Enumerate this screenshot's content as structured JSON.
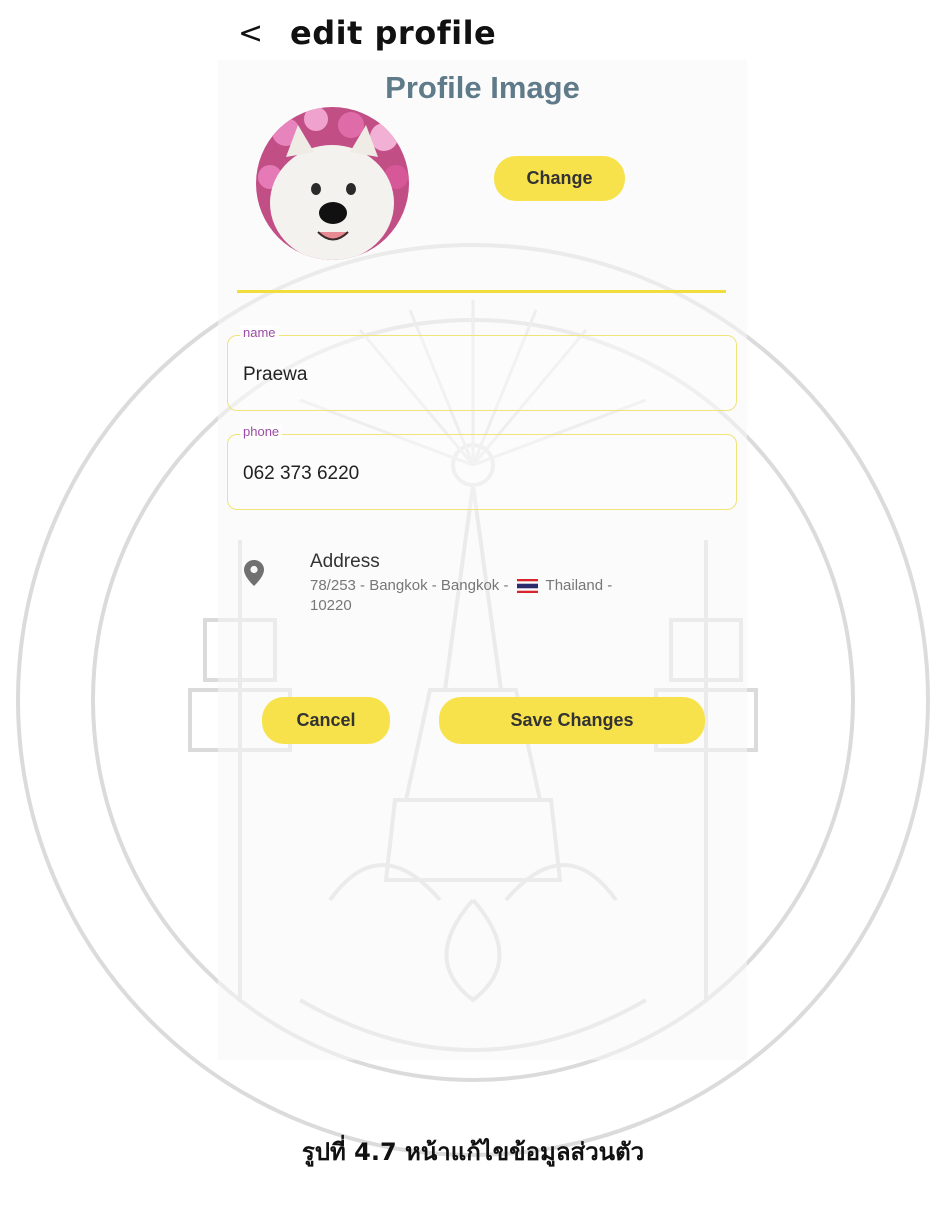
{
  "header": {
    "back_label": "<",
    "title": "edit profile"
  },
  "profile": {
    "section_title": "Profile Image",
    "change_label": "Change"
  },
  "form": {
    "name": {
      "label": "name",
      "value": "Praewa"
    },
    "phone": {
      "label": "phone",
      "value": "062 373 6220"
    },
    "address": {
      "title": "Address",
      "line_before_flag": "78/253 - Bangkok - Bangkok -",
      "line_after_flag": "Thailand -",
      "postcode": "10220"
    }
  },
  "actions": {
    "cancel_label": "Cancel",
    "save_label": "Save Changes"
  },
  "caption": "รูปที่ 4.7  หน้าแก้ไขข้อมูลส่วนตัว",
  "colors": {
    "accent_yellow": "#f7e24c",
    "title_blue_gray": "#5f7b8a",
    "label_purple": "#9b4ca8"
  },
  "icons": [
    "back-arrow-icon",
    "location-pin-icon",
    "thailand-flag-icon"
  ]
}
